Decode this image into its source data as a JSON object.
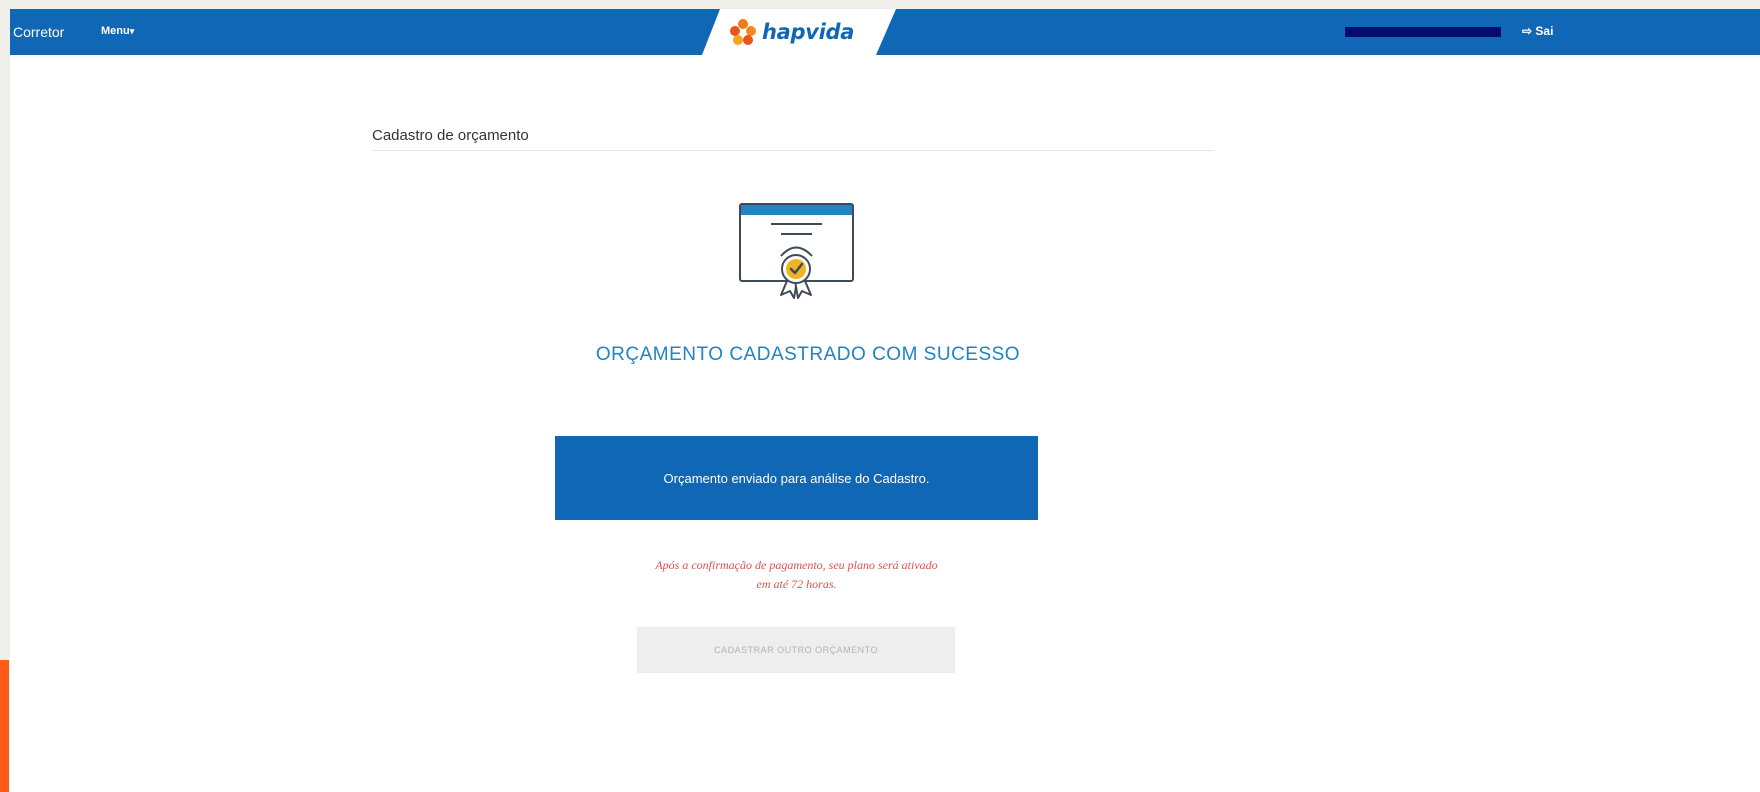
{
  "navbar": {
    "brand": "Corretor",
    "menu_label": "Menu",
    "menu_caret": "▾",
    "logo_text": "hapvida",
    "logout_icon": "sign-out-icon",
    "logout_glyph": "⇨",
    "logout_label": "Sai",
    "colors": {
      "bar": "#0f67b5",
      "user_redaction": "#000d6e"
    }
  },
  "page": {
    "section_title": "Cadastro de orçamento"
  },
  "result": {
    "icon": "certificate-icon",
    "title": "ORÇAMENTO CADASTRADO COM SUCESSO",
    "message": "Orçamento enviado para análise do Cadastro.",
    "note_line1": "Após a confirmação de pagamento, seu plano será ativado",
    "note_line2": "em até 72 horas.",
    "secondary_button": "CADASTRAR OUTRO ORÇAMENTO",
    "colors": {
      "title": "#1f83c4",
      "note": "#d9534f",
      "box": "#0f67b5",
      "badge": "#f0b323"
    }
  }
}
